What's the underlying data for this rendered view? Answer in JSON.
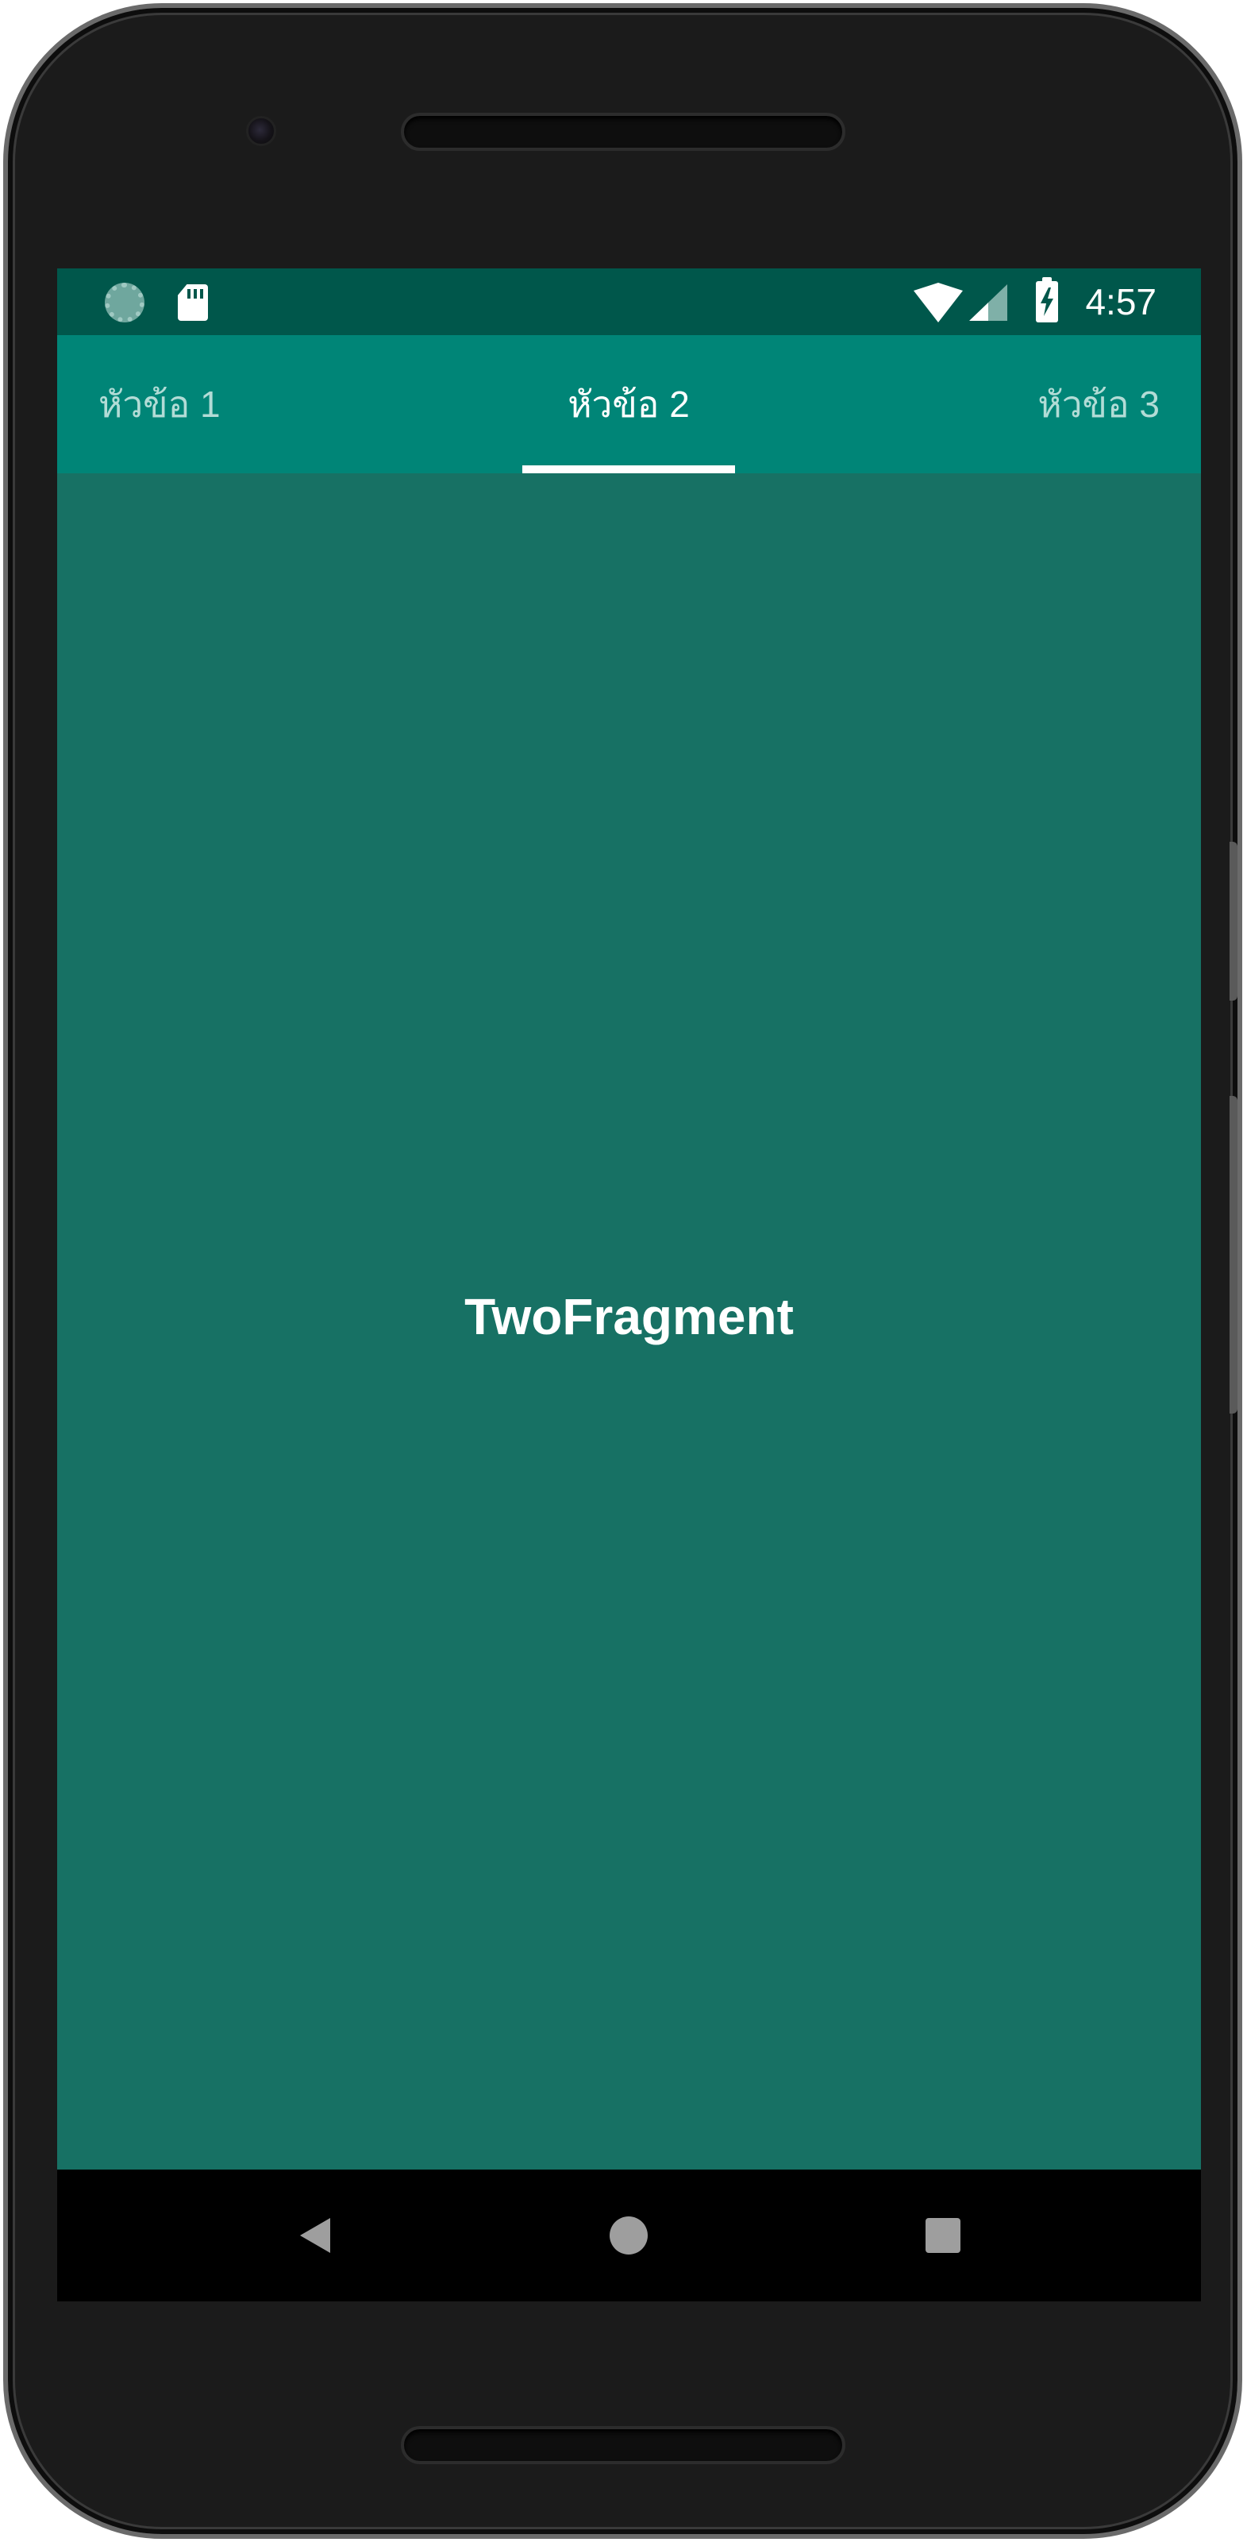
{
  "status_bar": {
    "time": "4:57",
    "icons": [
      "sync-icon",
      "sd-card-icon",
      "wifi-icon",
      "cell-signal-icon",
      "battery-charging-icon"
    ]
  },
  "tabs": [
    {
      "label": "หัวข้อ 1",
      "selected": false
    },
    {
      "label": "หัวข้อ 2",
      "selected": true
    },
    {
      "label": "หัวข้อ 3",
      "selected": false
    }
  ],
  "content": {
    "text": "TwoFragment"
  },
  "nav_bar": {
    "icons": [
      "back-icon",
      "home-icon",
      "recents-icon"
    ]
  },
  "colors": {
    "status_bar": "#00574b",
    "tab_bar": "#008577",
    "content_bg": "#177164",
    "indicator": "#ffffff",
    "nav_bar": "#000000"
  }
}
